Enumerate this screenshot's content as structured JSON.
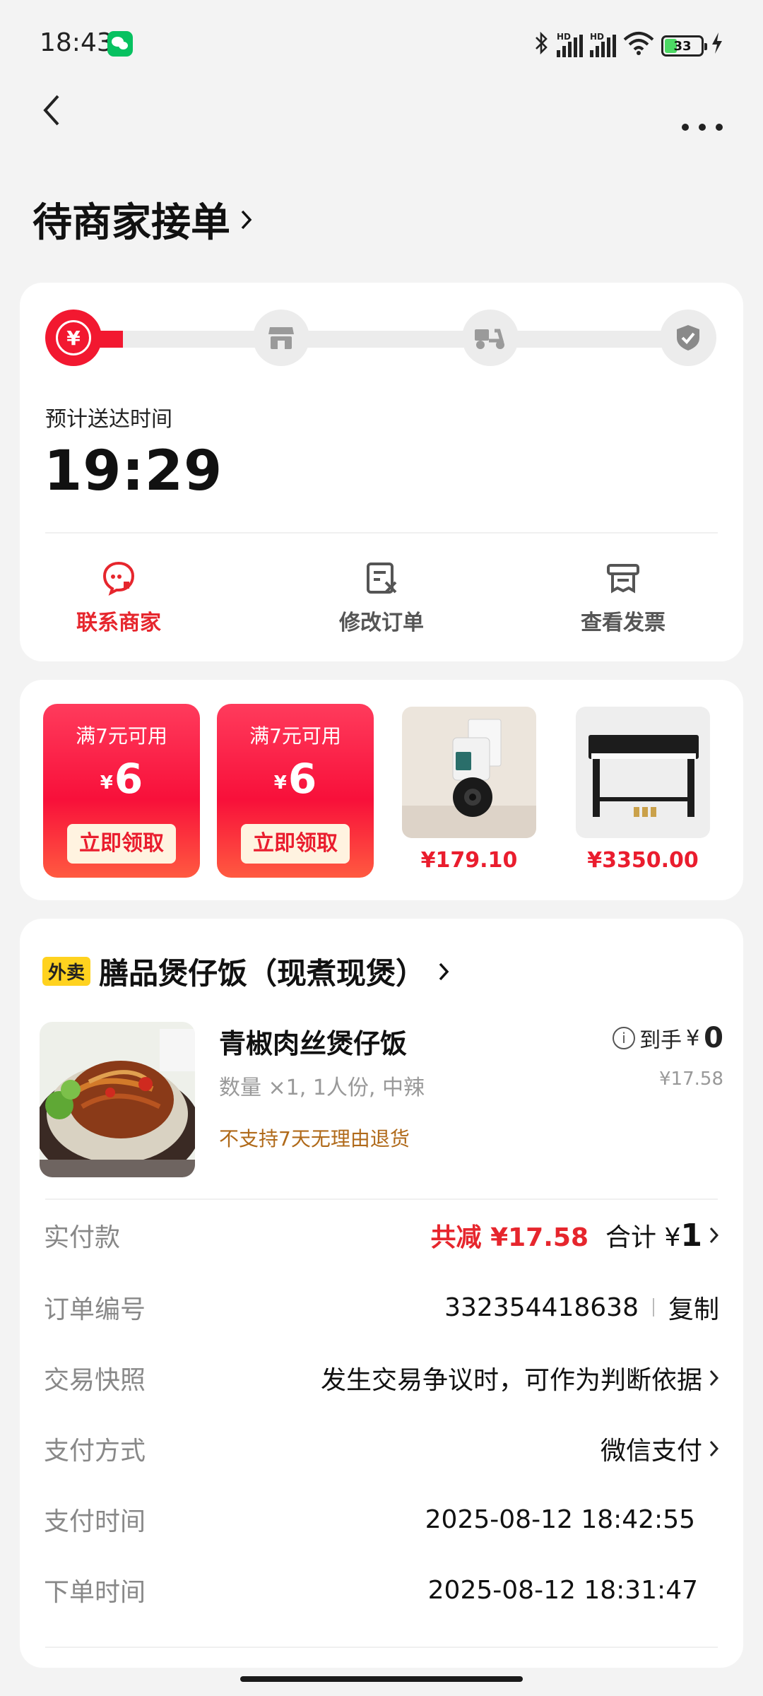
{
  "status_bar": {
    "time": "18:43",
    "signal_label": "HD",
    "battery": "33"
  },
  "header": {
    "back_icon": "chevron-left-icon",
    "more_icon": "more-icon",
    "title": "待商家接单"
  },
  "progress": {
    "steps": [
      "payment",
      "store",
      "delivery",
      "done"
    ],
    "active_index": 0,
    "fill_fraction": 0.08,
    "eta_label": "预计送达时间",
    "eta_time": "19:29"
  },
  "actions": [
    {
      "label": "联系商家",
      "icon": "chat-icon",
      "active": true
    },
    {
      "label": "修改订单",
      "icon": "edit-order-icon",
      "active": false
    },
    {
      "label": "查看发票",
      "icon": "invoice-icon",
      "active": false
    }
  ],
  "promos": {
    "coupons": [
      {
        "condition": "满7元可用",
        "currency": "¥",
        "amount": "6",
        "claim": "立即领取"
      },
      {
        "condition": "满7元可用",
        "currency": "¥",
        "amount": "6",
        "claim": "立即领取"
      }
    ],
    "products": [
      {
        "name": "camera",
        "price": "¥179.10"
      },
      {
        "name": "piano",
        "price": "¥3350.00"
      }
    ]
  },
  "order": {
    "channel_tag": "外卖",
    "store_name": "膳品煲仔饭（现煮现煲）",
    "item": {
      "name": "青椒肉丝煲仔饭",
      "spec": "数量 ×1, 1人份, 中辣",
      "note": "不支持7天无理由退货",
      "final_label": "到手",
      "final_currency": "¥",
      "final_price": "0",
      "original_price": "¥17.58"
    },
    "rows": {
      "paid": {
        "label": "实付款",
        "discount": "共减 ¥17.58",
        "total_label": "合计 ¥",
        "total": "1"
      },
      "order_no": {
        "label": "订单编号",
        "value": "332354418638",
        "copy": "复制"
      },
      "snapshot": {
        "label": "交易快照",
        "value": "发生交易争议时，可作为判断依据"
      },
      "pay_method": {
        "label": "支付方式",
        "value": "微信支付"
      },
      "pay_time": {
        "label": "支付时间",
        "value": "2025-08-12 18:42:55"
      },
      "order_time": {
        "label": "下单时间",
        "value": "2025-08-12 18:31:47"
      }
    }
  },
  "colors": {
    "brand_red": "#f21830",
    "action_red": "#e6262d",
    "tag_yellow": "#ffd21f",
    "note_brown": "#b06a1a"
  }
}
